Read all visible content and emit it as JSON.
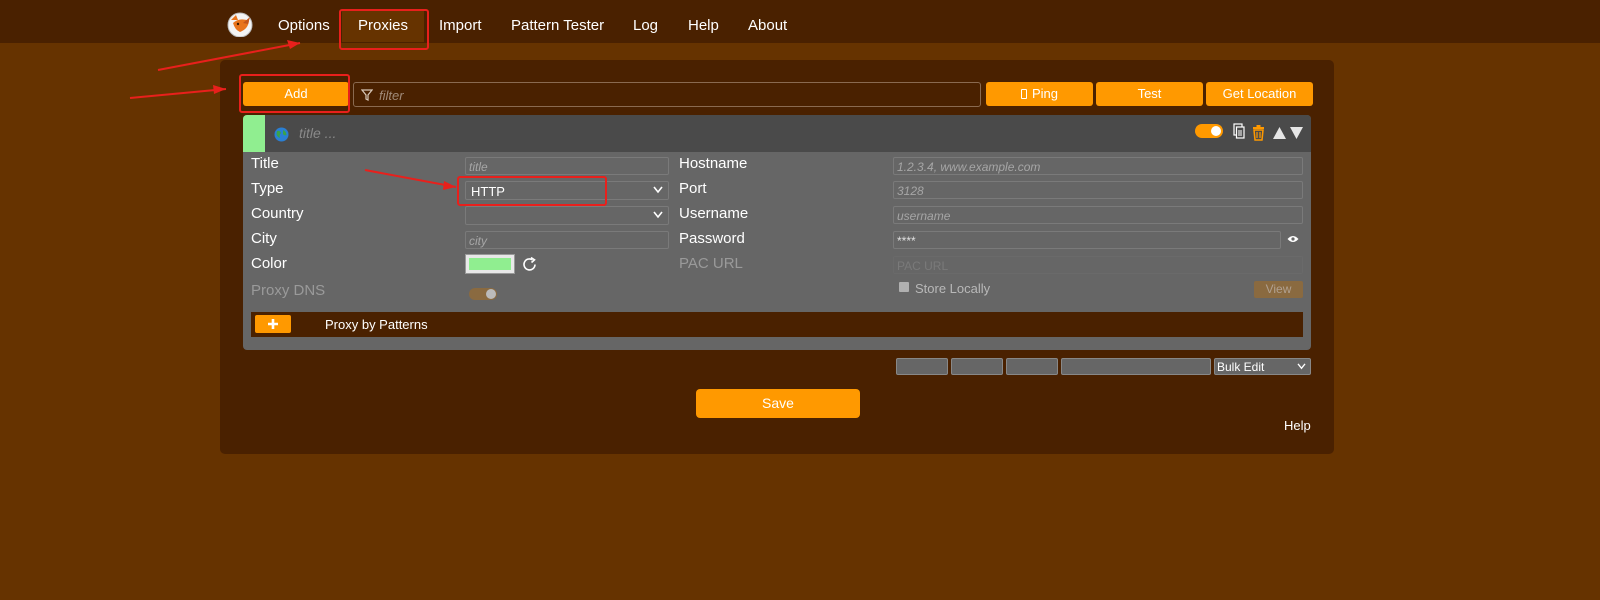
{
  "nav": {
    "items": [
      "Options",
      "Proxies",
      "Import",
      "Pattern Tester",
      "Log",
      "Help",
      "About"
    ],
    "active": "Proxies",
    "logo_icon": "fox-logo"
  },
  "toolbar": {
    "add_label": "Add",
    "filter_placeholder": "filter",
    "ping_label": "Ping",
    "ping_icon": "phone-icon",
    "test_label": "Test",
    "get_location_label": "Get Location"
  },
  "proxy": {
    "color": "#90ee90",
    "title_placeholder": "title ...",
    "enabled": true,
    "fields": {
      "title_label": "Title",
      "title_placeholder": "title",
      "type_label": "Type",
      "type_value": "HTTP",
      "country_label": "Country",
      "country_value": "",
      "city_label": "City",
      "city_placeholder": "city",
      "color_label": "Color",
      "proxy_dns_label": "Proxy DNS",
      "hostname_label": "Hostname",
      "hostname_placeholder": "1.2.3.4, www.example.com",
      "port_label": "Port",
      "port_placeholder": "3128",
      "username_label": "Username",
      "username_placeholder": "username",
      "password_label": "Password",
      "password_value": "****",
      "pac_url_label": "PAC URL",
      "pac_url_placeholder": "PAC URL",
      "store_locally_label": "Store Locally",
      "view_label": "View"
    },
    "patterns": {
      "add_icon": "plus-icon",
      "label": "Proxy by Patterns"
    }
  },
  "bulk": {
    "select_value": "Bulk Edit"
  },
  "footer": {
    "save_label": "Save",
    "help_label": "Help"
  },
  "colors": {
    "accent": "#ff9900",
    "page_bg": "#663300",
    "panel_bg": "#4a2100",
    "annotation": "#e8201c"
  }
}
